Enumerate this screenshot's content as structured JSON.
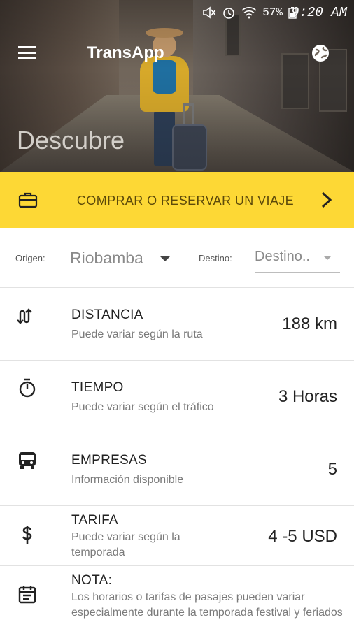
{
  "status_bar": {
    "battery": "57%",
    "time": "9:20 AM"
  },
  "header": {
    "app_title": "TransApp",
    "hero_title": "Descubre"
  },
  "cta": {
    "label": "COMPRAR O RESERVAR UN VIAJE"
  },
  "route": {
    "origin_label": "Origen:",
    "origin_value": "Riobamba",
    "destination_label": "Destino:",
    "destination_value": "Destino.."
  },
  "info": [
    {
      "title": "DISTANCIA",
      "subtitle": "Puede variar según la ruta",
      "value": "188 km",
      "icon": "route-arrows-icon"
    },
    {
      "title": "TIEMPO",
      "subtitle": "Puede variar según el tráfico",
      "value": "3 Horas",
      "icon": "stopwatch-icon"
    },
    {
      "title": "EMPRESAS",
      "subtitle": "Información disponible",
      "value": "5",
      "icon": "bus-icon"
    },
    {
      "title": "TARIFA",
      "subtitle": "Puede variar según la temporada",
      "value": "4 -5 USD",
      "icon": "dollar-icon"
    },
    {
      "title": "NOTA:",
      "subtitle": "Los horarios o tarifas de pasajes pueden variar especialmente durante la temporada festival y feriados",
      "value": "",
      "icon": "calendar-icon"
    }
  ],
  "colors": {
    "accent": "#fdd835",
    "cta_text": "#5d4a0a"
  }
}
